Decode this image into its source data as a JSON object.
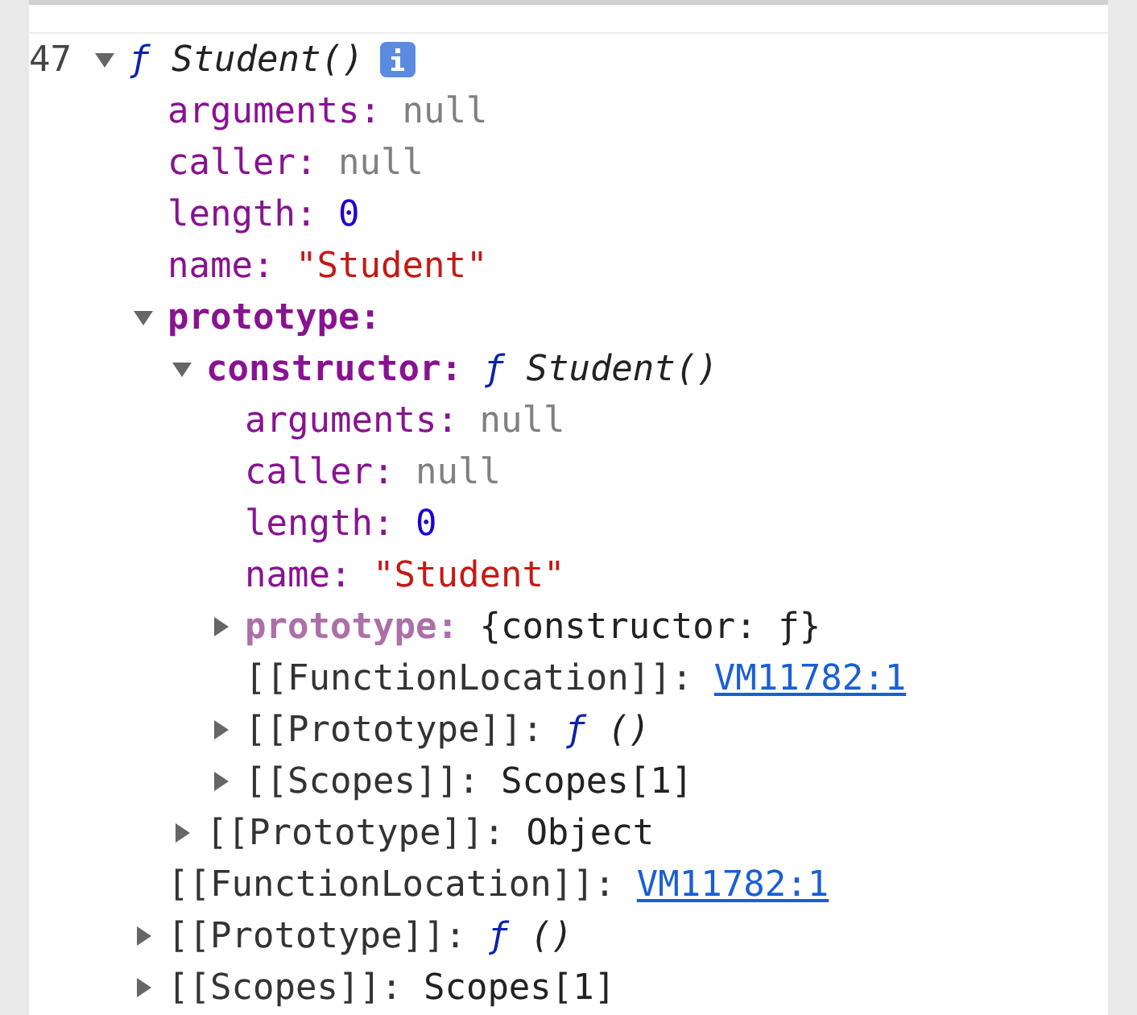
{
  "line_number": "47",
  "root": {
    "sign": "ƒ",
    "label": "Student()",
    "expanded": true,
    "children": [
      {
        "key": "arguments:",
        "internal": false,
        "non_enumerable": false,
        "value": "null",
        "kind": "null"
      },
      {
        "key": "caller:",
        "internal": false,
        "non_enumerable": false,
        "value": "null",
        "kind": "null"
      },
      {
        "key": "length:",
        "internal": false,
        "non_enumerable": false,
        "value": "0",
        "kind": "number"
      },
      {
        "key": "name:",
        "internal": false,
        "non_enumerable": false,
        "value": "\"Student\"",
        "kind": "string"
      },
      {
        "key": "prototype:",
        "internal": false,
        "non_enumerable": false,
        "expanded": true,
        "children": [
          {
            "key": "constructor:",
            "internal": false,
            "non_enumerable": false,
            "sign": "ƒ",
            "value": "Student()",
            "kind": "function",
            "expanded": true,
            "children": [
              {
                "key": "arguments:",
                "internal": false,
                "non_enumerable": false,
                "value": "null",
                "kind": "null"
              },
              {
                "key": "caller:",
                "internal": false,
                "non_enumerable": false,
                "value": "null",
                "kind": "null"
              },
              {
                "key": "length:",
                "internal": false,
                "non_enumerable": false,
                "value": "0",
                "kind": "number"
              },
              {
                "key": "name:",
                "internal": false,
                "non_enumerable": false,
                "value": "\"Student\"",
                "kind": "string"
              },
              {
                "key": "prototype:",
                "internal": false,
                "non_enumerable": true,
                "value": "{constructor: ƒ}",
                "kind": "object",
                "expanded": false
              },
              {
                "key": "[[FunctionLocation]]:",
                "internal": true,
                "non_enumerable": false,
                "value": "VM11782:1",
                "kind": "link"
              },
              {
                "key": "[[Prototype]]:",
                "internal": true,
                "non_enumerable": false,
                "sign": "ƒ",
                "value": "()",
                "kind": "function",
                "expanded": false
              },
              {
                "key": "[[Scopes]]:",
                "internal": true,
                "non_enumerable": false,
                "value": "Scopes[1]",
                "kind": "object",
                "expanded": false
              }
            ]
          },
          {
            "key": "[[Prototype]]:",
            "internal": true,
            "non_enumerable": false,
            "value": "Object",
            "kind": "object",
            "expanded": false
          }
        ]
      },
      {
        "key": "[[FunctionLocation]]:",
        "internal": true,
        "non_enumerable": false,
        "value": "VM11782:1",
        "kind": "link"
      },
      {
        "key": "[[Prototype]]:",
        "internal": true,
        "non_enumerable": false,
        "sign": "ƒ",
        "value": "()",
        "kind": "function",
        "expanded": false
      },
      {
        "key": "[[Scopes]]:",
        "internal": true,
        "non_enumerable": false,
        "value": "Scopes[1]",
        "kind": "object",
        "expanded": false
      }
    ]
  }
}
